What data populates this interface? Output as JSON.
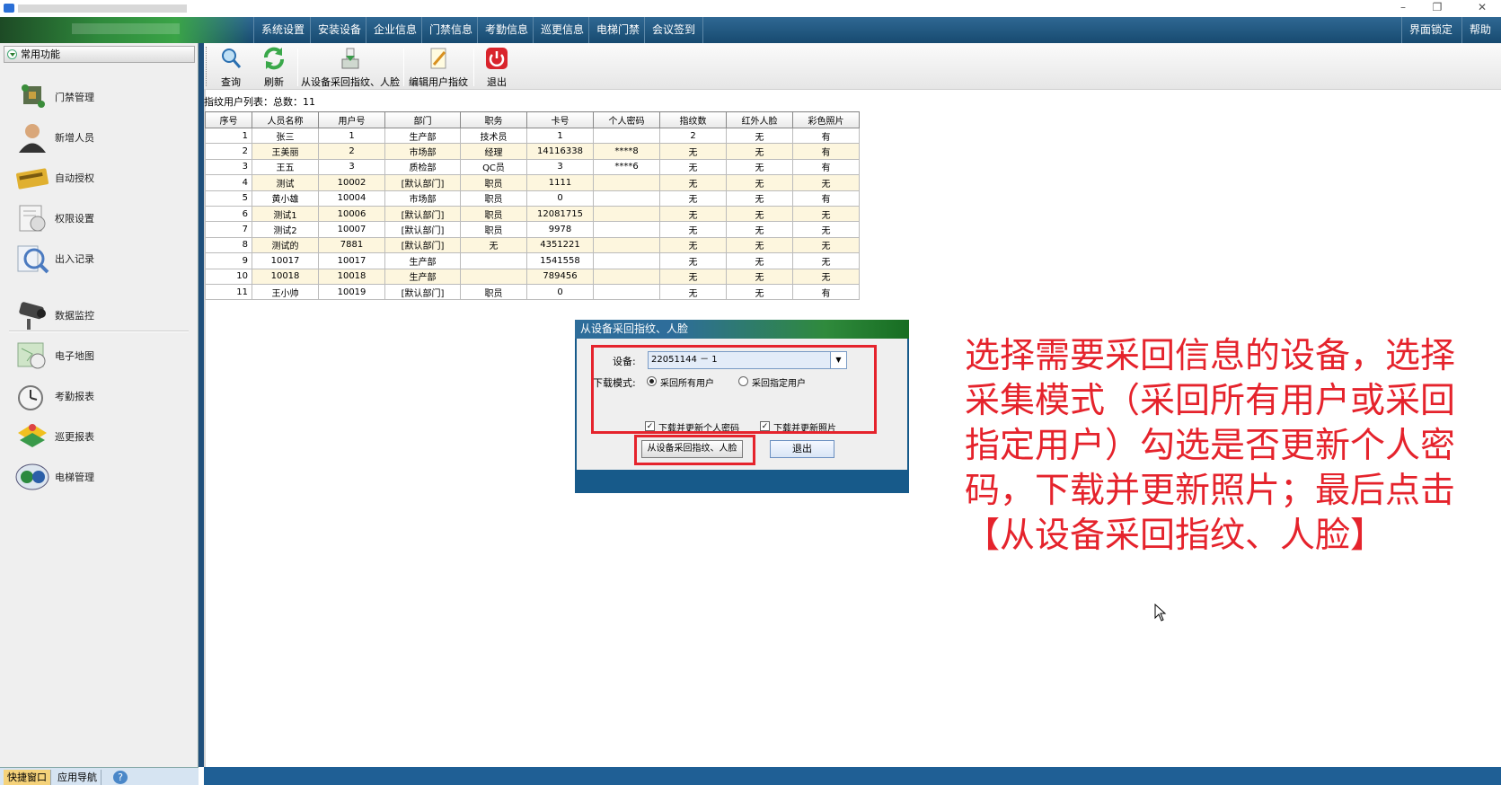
{
  "window": {
    "minimize_glyph": "–",
    "restore_glyph": "❐",
    "close_glyph": "✕"
  },
  "menu": {
    "items": [
      "系统设置",
      "安装设备",
      "企业信息",
      "门禁信息",
      "考勤信息",
      "巡更信息",
      "电梯门禁",
      "会议签到"
    ],
    "right_items": [
      "界面锁定",
      "帮助"
    ]
  },
  "sidebar": {
    "header": "常用功能",
    "items": [
      "门禁管理",
      "新增人员",
      "自动授权",
      "权限设置",
      "出入记录",
      "数据监控",
      "电子地图",
      "考勤报表",
      "巡更报表",
      "电梯管理"
    ],
    "icons": [
      "door-access-icon",
      "add-person-icon",
      "auto-authorize-icon",
      "permission-icon",
      "access-record-icon",
      "monitor-icon",
      "map-icon",
      "attendance-report-icon",
      "patrol-report-icon",
      "elevator-icon"
    ]
  },
  "toolbar": {
    "query": "查询",
    "refresh": "刷新",
    "fetch": "从设备采回指纹、人脸",
    "edit": "编辑用户指纹",
    "exit": "退出"
  },
  "list": {
    "label": "指纹用户列表：总数：11",
    "columns": [
      "序号",
      "人员名称",
      "用户号",
      "部门",
      "职务",
      "卡号",
      "个人密码",
      "指纹数",
      "红外人脸",
      "彩色照片"
    ],
    "rows": [
      [
        "1",
        "张三",
        "1",
        "生产部",
        "技术员",
        "1",
        "",
        "2",
        "无",
        "有"
      ],
      [
        "2",
        "王美丽",
        "2",
        "市场部",
        "经理",
        "14116338",
        "****8",
        "无",
        "无",
        "有"
      ],
      [
        "3",
        "王五",
        "3",
        "质检部",
        "QC员",
        "3",
        "****6",
        "无",
        "无",
        "有"
      ],
      [
        "4",
        "测试",
        "10002",
        "[默认部门]",
        "职员",
        "1111",
        "",
        "无",
        "无",
        "无"
      ],
      [
        "5",
        "黄小雄",
        "10004",
        "市场部",
        "职员",
        "0",
        "",
        "无",
        "无",
        "有"
      ],
      [
        "6",
        "测试1",
        "10006",
        "[默认部门]",
        "职员",
        "12081715",
        "",
        "无",
        "无",
        "无"
      ],
      [
        "7",
        "测试2",
        "10007",
        "[默认部门]",
        "职员",
        "9978",
        "",
        "无",
        "无",
        "无"
      ],
      [
        "8",
        "测试的",
        "7881",
        "[默认部门]",
        "无",
        "4351221",
        "",
        "无",
        "无",
        "无"
      ],
      [
        "9",
        "10017",
        "10017",
        "生产部",
        "",
        "1541558",
        "",
        "无",
        "无",
        "无"
      ],
      [
        "10",
        "10018",
        "10018",
        "生产部",
        "",
        "789456",
        "",
        "无",
        "无",
        "无"
      ],
      [
        "11",
        "王小帅",
        "10019",
        "[默认部门]",
        "职员",
        "0",
        "",
        "无",
        "无",
        "有"
      ]
    ]
  },
  "dialog": {
    "title": "从设备采回指纹、人脸",
    "device_label": "设备:",
    "device_value": "22051144 － 1",
    "mode_label": "下载模式:",
    "mode_all": "采回所有用户",
    "mode_specific": "采回指定用户",
    "update_password": "下载并更新个人密码",
    "update_photo": "下载并更新照片",
    "fetch_button": "从设备采回指纹、人脸",
    "exit_button": "退出"
  },
  "annotation": "选择需要采回信息的设备，选择采集模式（采回所有用户或采回指定用户）勾选是否更新个人密码，下载并更新照片；最后点击【从设备采回指纹、人脸】",
  "statusbar": {
    "tab_quick": "快捷窗口",
    "tab_nav": "应用导航",
    "help": "?"
  },
  "colors": {
    "accent_red": "#e5232c",
    "menubar_blue": "#1f5f95",
    "row_alt": "#fdf6de"
  }
}
